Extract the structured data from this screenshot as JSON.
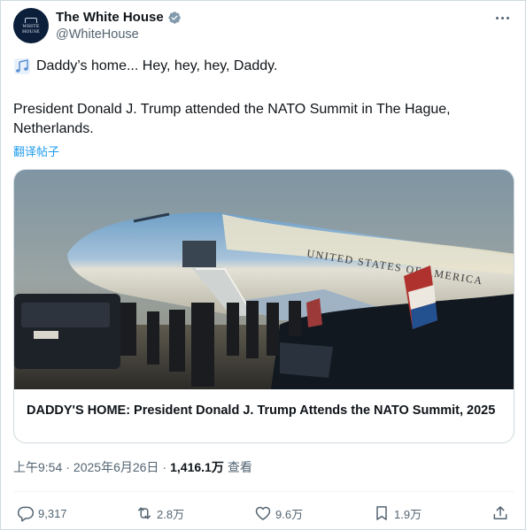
{
  "account": {
    "display_name": "The White House",
    "handle": "@WhiteHouse",
    "avatar_text_line1": "WHITE",
    "avatar_text_line2": "HOUSE",
    "verified_color": "#829aab"
  },
  "post": {
    "line1": "Daddy’s home... Hey, hey, hey, Daddy.",
    "line1_icon": "musical-notes-icon",
    "paragraph": "President Donald J. Trump attended the NATO Summit in The Hague, Netherlands.",
    "translate_label": "翻译帖子"
  },
  "card": {
    "caption": "DADDY'S HOME: President Donald J. Trump Attends the NATO Summit, 2025",
    "plane_lettering": "UNITED STATES OF AMERICA"
  },
  "meta": {
    "time": "上午9:54",
    "separator": "·",
    "date": "2025年6月26日",
    "views_count": "1,416.1万",
    "views_label": "查看"
  },
  "actions": {
    "replies": "9,317",
    "reposts": "2.8万",
    "likes": "9.6万",
    "bookmarks": "1.9万"
  },
  "colors": {
    "accent": "#1d9bf0",
    "text": "#0f1419",
    "secondary": "#536471",
    "border": "#cfd9de"
  }
}
